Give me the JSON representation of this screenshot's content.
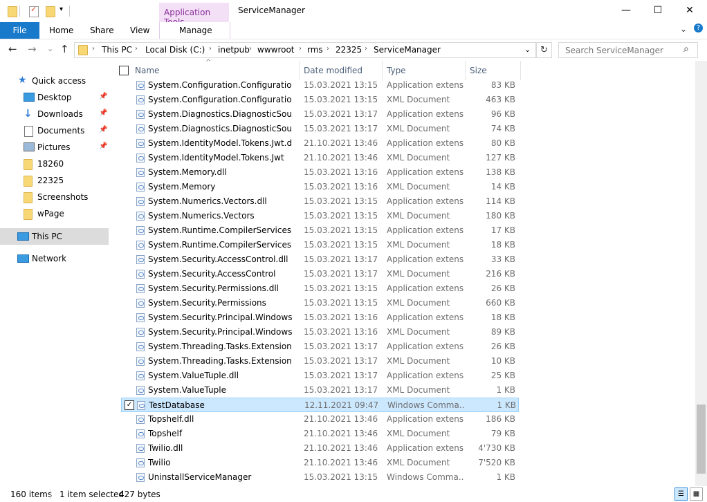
{
  "window": {
    "title": "ServiceManager",
    "context_tab": "Application Tools",
    "minimize": "—",
    "maximize": "☐",
    "close": "✕"
  },
  "ribbon": {
    "tabs": [
      "File",
      "Home",
      "Share",
      "View"
    ],
    "manage_label": "Manage",
    "expand_icon": "⌄",
    "help_icon": "?"
  },
  "navigation": {
    "back_icon": "←",
    "forward_icon": "→",
    "recent_icon": "⌄",
    "up_icon": "↑",
    "breadcrumbs": [
      "This PC",
      "Local Disk (C:)",
      "inetpub",
      "wwwroot",
      "rms",
      "22325",
      "ServiceManager"
    ],
    "dropdown_icon": "⌄",
    "refresh_icon": "↻",
    "search_placeholder": "Search ServiceManager",
    "search_icon": "⌕"
  },
  "sidebar": {
    "items": [
      {
        "label": "Quick access",
        "icon": "star-icon",
        "pinned": false
      },
      {
        "label": "Desktop",
        "icon": "desktop-icon",
        "pinned": true
      },
      {
        "label": "Downloads",
        "icon": "download-icon",
        "pinned": true
      },
      {
        "label": "Documents",
        "icon": "documents-icon",
        "pinned": true
      },
      {
        "label": "Pictures",
        "icon": "pictures-icon",
        "pinned": true
      },
      {
        "label": "18260",
        "icon": "folder-icon",
        "pinned": false
      },
      {
        "label": "22325",
        "icon": "folder-icon",
        "pinned": false
      },
      {
        "label": "Screenshots",
        "icon": "folder-icon",
        "pinned": false
      },
      {
        "label": "wPage",
        "icon": "folder-icon",
        "pinned": false
      },
      {
        "label": "This PC",
        "icon": "computer-icon",
        "pinned": false
      },
      {
        "label": "Network",
        "icon": "network-icon",
        "pinned": false
      }
    ]
  },
  "columns": {
    "name": "Name",
    "date": "Date modified",
    "type": "Type",
    "size": "Size",
    "sort_icon": "^"
  },
  "files": [
    {
      "name": "System.Configuration.Configuration...",
      "date": "15.03.2021 13:15",
      "type": "Application extens...",
      "size": "83 KB"
    },
    {
      "name": "System.Configuration.Configuration...",
      "date": "15.03.2021 13:15",
      "type": "XML Document",
      "size": "463 KB"
    },
    {
      "name": "System.Diagnostics.DiagnosticSource....",
      "date": "15.03.2021 13:17",
      "type": "Application extens...",
      "size": "96 KB"
    },
    {
      "name": "System.Diagnostics.DiagnosticSource",
      "date": "15.03.2021 13:17",
      "type": "XML Document",
      "size": "74 KB"
    },
    {
      "name": "System.IdentityModel.Tokens.Jwt.dll",
      "date": "21.10.2021 13:46",
      "type": "Application extens...",
      "size": "80 KB"
    },
    {
      "name": "System.IdentityModel.Tokens.Jwt",
      "date": "21.10.2021 13:46",
      "type": "XML Document",
      "size": "127 KB"
    },
    {
      "name": "System.Memory.dll",
      "date": "15.03.2021 13:16",
      "type": "Application extens...",
      "size": "138 KB"
    },
    {
      "name": "System.Memory",
      "date": "15.03.2021 13:16",
      "type": "XML Document",
      "size": "14 KB"
    },
    {
      "name": "System.Numerics.Vectors.dll",
      "date": "15.03.2021 13:15",
      "type": "Application extens...",
      "size": "114 KB"
    },
    {
      "name": "System.Numerics.Vectors",
      "date": "15.03.2021 13:15",
      "type": "XML Document",
      "size": "180 KB"
    },
    {
      "name": "System.Runtime.CompilerServices.Un...",
      "date": "15.03.2021 13:15",
      "type": "Application extens...",
      "size": "17 KB"
    },
    {
      "name": "System.Runtime.CompilerServices.Un...",
      "date": "15.03.2021 13:15",
      "type": "XML Document",
      "size": "18 KB"
    },
    {
      "name": "System.Security.AccessControl.dll",
      "date": "15.03.2021 13:17",
      "type": "Application extens...",
      "size": "33 KB"
    },
    {
      "name": "System.Security.AccessControl",
      "date": "15.03.2021 13:17",
      "type": "XML Document",
      "size": "216 KB"
    },
    {
      "name": "System.Security.Permissions.dll",
      "date": "15.03.2021 13:15",
      "type": "Application extens...",
      "size": "26 KB"
    },
    {
      "name": "System.Security.Permissions",
      "date": "15.03.2021 13:15",
      "type": "XML Document",
      "size": "660 KB"
    },
    {
      "name": "System.Security.Principal.Windows.dll",
      "date": "15.03.2021 13:16",
      "type": "Application extens...",
      "size": "18 KB"
    },
    {
      "name": "System.Security.Principal.Windows",
      "date": "15.03.2021 13:16",
      "type": "XML Document",
      "size": "89 KB"
    },
    {
      "name": "System.Threading.Tasks.Extensions.dll",
      "date": "15.03.2021 13:17",
      "type": "Application extens...",
      "size": "26 KB"
    },
    {
      "name": "System.Threading.Tasks.Extensions",
      "date": "15.03.2021 13:17",
      "type": "XML Document",
      "size": "10 KB"
    },
    {
      "name": "System.ValueTuple.dll",
      "date": "15.03.2021 13:17",
      "type": "Application extens...",
      "size": "25 KB"
    },
    {
      "name": "System.ValueTuple",
      "date": "15.03.2021 13:17",
      "type": "XML Document",
      "size": "1 KB"
    },
    {
      "name": "TestDatabase",
      "date": "12.11.2021 09:47",
      "type": "Windows Comma...",
      "size": "1 KB",
      "selected": true
    },
    {
      "name": "Topshelf.dll",
      "date": "21.10.2021 13:46",
      "type": "Application extens...",
      "size": "186 KB"
    },
    {
      "name": "Topshelf",
      "date": "21.10.2021 13:46",
      "type": "XML Document",
      "size": "79 KB"
    },
    {
      "name": "Twilio.dll",
      "date": "21.10.2021 13:46",
      "type": "Application extens...",
      "size": "4'730 KB"
    },
    {
      "name": "Twilio",
      "date": "21.10.2021 13:46",
      "type": "XML Document",
      "size": "7'520 KB"
    },
    {
      "name": "UninstallServiceManager",
      "date": "15.03.2021 13:15",
      "type": "Windows Comma...",
      "size": "1 KB"
    }
  ],
  "status": {
    "item_count": "160 items",
    "selection": "1 item selected",
    "selection_size": "427 bytes",
    "check_mark": "✓"
  }
}
